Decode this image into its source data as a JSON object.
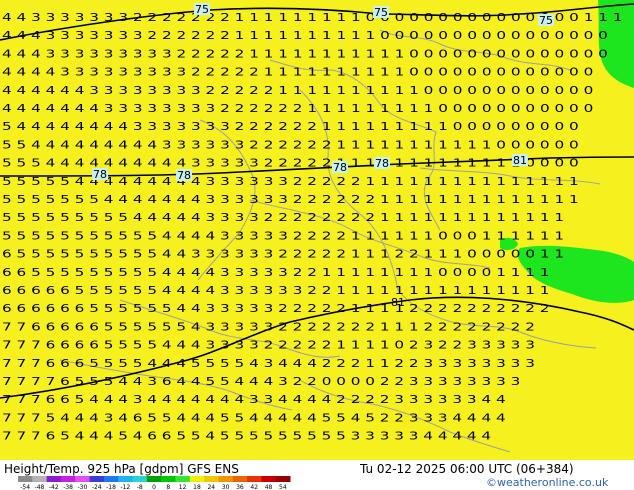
{
  "title": "Height/Temp. 925 hPa [gdpm] GFS ENS",
  "valid_time": "Tu 02-12  2025 06:00 UTC (06+384)",
  "credit": "©weatheronline.co.uk",
  "contour_labels": [
    "75",
    "75",
    "75",
    "78",
    "78",
    "78",
    "78",
    "81"
  ],
  "colorbar": {
    "ticks": [
      "-54",
      "-48",
      "-42",
      "-38",
      "-30",
      "-24",
      "-18",
      "-12",
      "-8",
      "0",
      "8",
      "12",
      "18",
      "24",
      "30",
      "36",
      "42",
      "48",
      "54"
    ],
    "colors": [
      "#8c8c8c",
      "#b4b4b4",
      "#8c1cd2",
      "#c81ee6",
      "#e650f0",
      "#3c3cdc",
      "#1e78f0",
      "#1eb4f0",
      "#28d2d2",
      "#00a000",
      "#00c800",
      "#32e632",
      "#f0f000",
      "#f0c800",
      "#f09600",
      "#f06400",
      "#e63200",
      "#c80000",
      "#960000"
    ]
  },
  "legend_colors": {
    "yellow": "#f5f01e",
    "green": "#1ee61e",
    "contour": "#000000",
    "border": "#a0a0a0"
  },
  "map_rows": [
    "4 4 3 3 3 3 3 3 3 2 2 2 2 2 2 2 1 1 1 1 1 1 1 1 1 0 0 0 0 0 0 0 0 0 0 0 0 0 0 0 1 1 1",
    "4 4 4 3 3 3 3 3 3 3 2 2 2 2 2 2 1 1 1 1 1 1 1 1 1 1 0 0 0 0 0 0 0 0 0 0 0 0 0 0 0 0",
    "4 4 4 3 3 3 3 3 3 3 3 3 2 2 2 2 2 1 1 1 1 1 1 1 1 1 1 1 0 0 0 0 0 0 0 0 0 0 0 0 0 0",
    "4 4 4 4 3 3 3 3 3 3 3 3 3 2 2 2 2 2 1 1 1 1 1 1 1 1 1 1 0 0 0 0 0 0 0 0 0 0 0 0 0",
    "4 4 4 4 4 4 3 3 3 3 3 3 3 3 2 2 2 2 2 1 1 1 1 1 1 1 1 1 1 0 0 0 0 0 0 0 0 0 0 0 0",
    "4 4 4 4 4 4 4 3 3 3 3 3 3 3 3 2 2 2 2 2 2 1 1 1 1 1 1 1 1 1 0 0 0 0 0 0 0 0 0 0 0",
    "5 4 4 4 4 4 4 4 4 3 3 3 3 3 3 3 2 2 2 2 2 2 1 1 1 1 1 1 1 1 1 0 0 0 0 0 0 0 0 0",
    "5 5 4 4 4 4 4 4 4 4 4 3 3 3 3 3 3 2 2 2 2 2 2 1 1 1 1 1 1 1 1 1 1 1 0 0 0 0 0 0",
    "5 5 5 4 4 4 4 4 4 4 4 4 4 3 3 3 3 3 2 2 2 2 2 1 1 1 1 1 1 1 1 1 1 1 1 1 0 0 0 0",
    "5 5 5 5 5 4 4 4 4 4 4 4 4 4 3 3 3 3 3 3 2 2 2 2 2 1 1 1 1 1 1 1 1 1 1 1 1 1 1 1",
    "5 5 5 5 5 5 5 4 4 4 4 4 4 4 3 3 3 3 3 3 2 2 2 2 2 2 1 1 1 1 1 1 1 1 1 1 1 1 1 1",
    "5 5 5 5 5 5 5 5 5 4 4 4 4 4 3 3 3 3 2 2 2 2 2 2 2 2 1 1 1 1 1 1 1 1 1 1 1 1 1",
    "5 5 5 5 5 5 5 5 5 5 5 4 4 4 4 3 3 3 3 3 2 2 2 2 1 1 1 1 1 1 0 0 0 1 1 1 1 1 1",
    "6 5 5 5 5 5 5 5 5 5 5 4 4 3 3 3 3 3 3 2 2 2 2 2 1 1 1 2 2 1 1 1 0 0 0 0 0 1 1",
    "6 6 5 5 5 5 5 5 5 5 5 4 4 4 4 3 3 3 3 3 2 2 1 1 1 1 1 1 1 1 0 0 0 0 1 1 1 1",
    "6 6 6 6 6 5 5 5 5 5 5 4 4 4 4 3 3 3 3 3 3 2 2 1 1 1 1 1 1 1 1 1 1 1 1 1 1 1",
    "6 6 6 6 6 6 5 5 5 5 5 5 4 4 3 3 3 3 3 2 2 2 2 2 1 1 1 1 2 2 2 2 2 2 2 2 2 2",
    "7 7 6 6 6 6 6 5 5 5 5 5 5 4 3 3 3 3 3 2 2 2 2 2 2 2 1 1 1 2 2 2 2 2 2 2 2",
    "7 7 7 6 6 6 6 5 5 5 5 4 4 4 3 3 3 3 2 2 2 2 2 1 1 1 1 0 2 3 2 2 3 3 3 3 3",
    "7 7 7 6 6 6 5 5 5 5 4 4 4 5 5 5 5 4 3 4 4 4 2 2 2 1 1 2 2 3 3 3 3 3 3 3 3",
    "7 7 7 7 6 5 5 5 4 4 3 6 4 4 5 5 4 4 4 3 2 2 0 0 0 0 2 2 3 3 3 3 3 3 3 3",
    "7 7 7 6 6 5 4 4 4 3 4 4 4 4 4 4 4 3 3 4 4 4 4 2 2 2 2 3 3 3 3 3 3 4 4",
    "7 7 7 5 4 4 4 3 4 6 5 5 4 4 4 5 5 4 4 4 4 4 5 5 4 5 2 2 3 3 3 4 4 4 4",
    "7 7 7 6 5 4 4 4 5 4 6 6 5 5 4 5 5 5 5 5 5 5 5 5 3 3 3 3 3 4 4 4 4 4"
  ]
}
